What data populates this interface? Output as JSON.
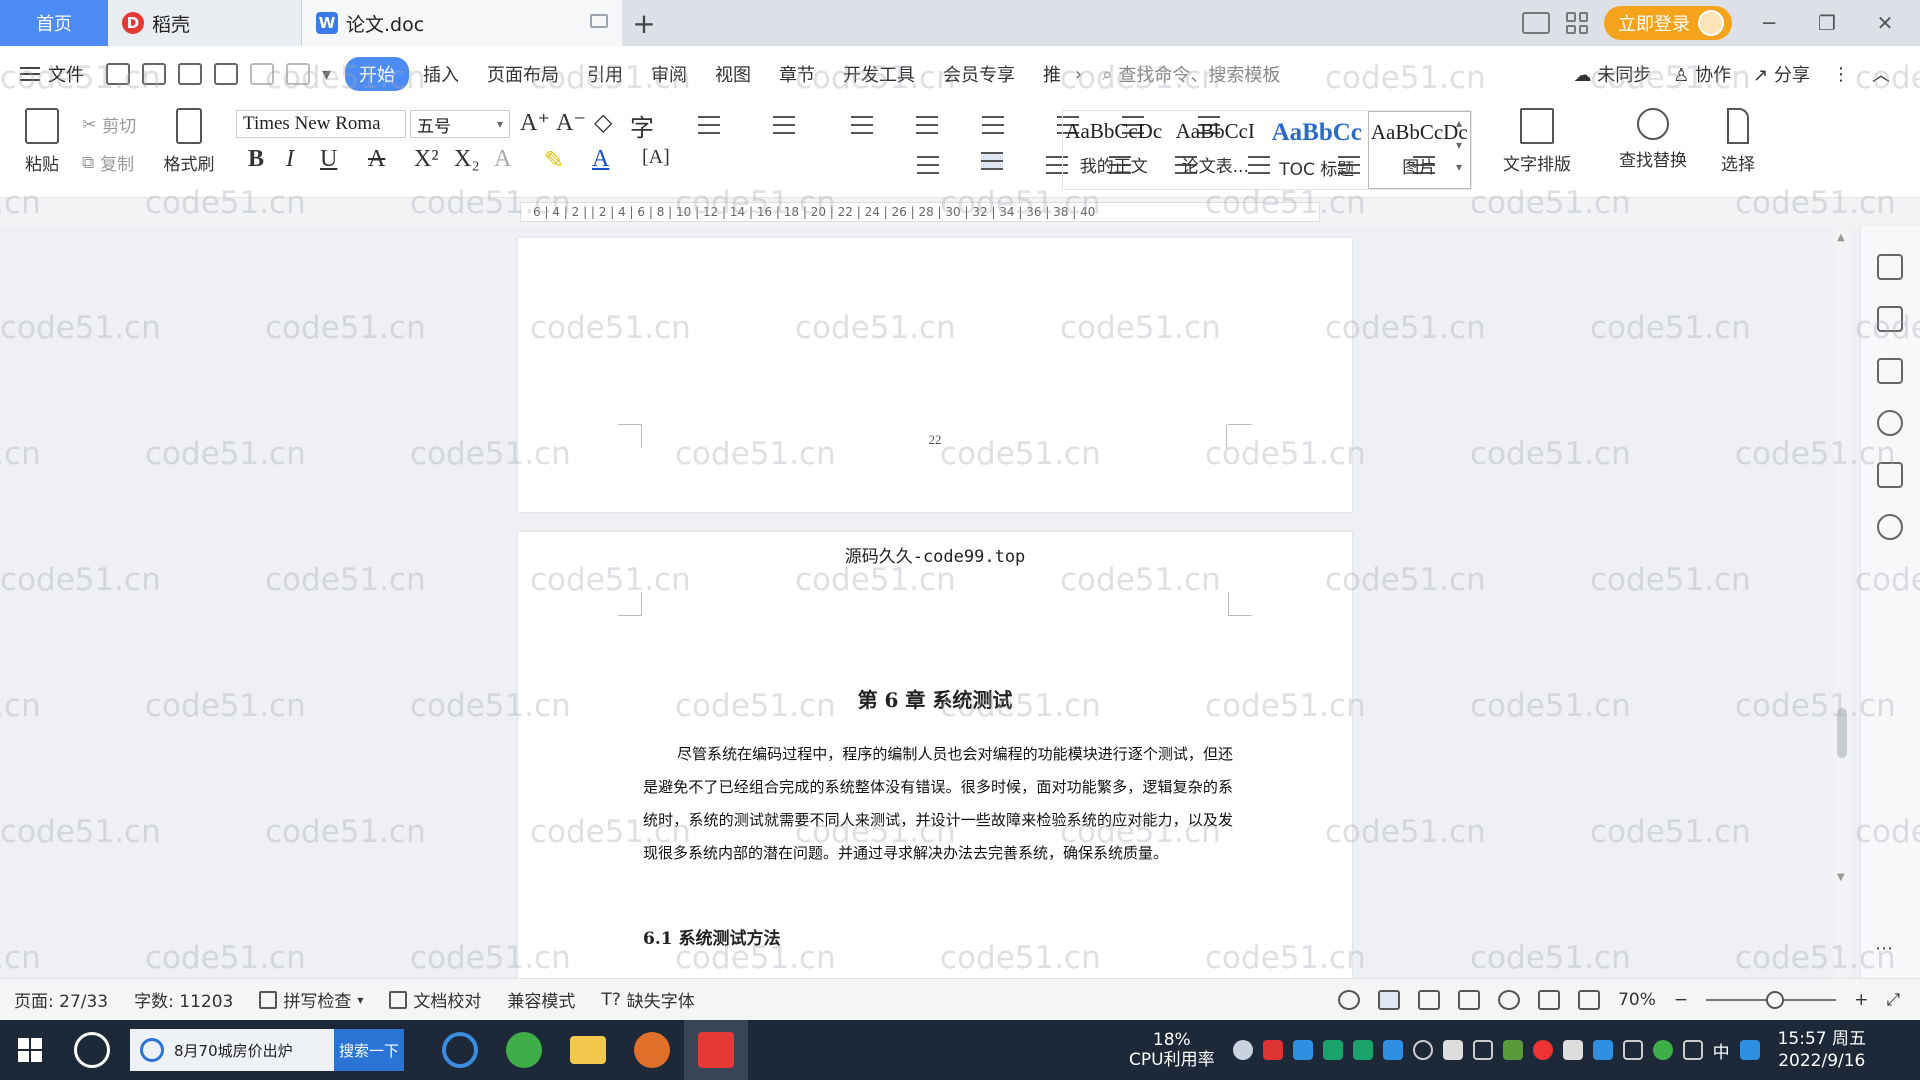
{
  "tabs": {
    "home": "首页",
    "daoke": "稻壳",
    "doc": "论文.doc"
  },
  "titlebar": {
    "login": "立即登录"
  },
  "menu": {
    "file": "文件",
    "items": [
      "开始",
      "插入",
      "页面布局",
      "引用",
      "审阅",
      "视图",
      "章节",
      "开发工具",
      "会员专享",
      "推"
    ],
    "search_cmd": "查找命令、搜索模板",
    "unsynced": "未同步",
    "collab": "协作",
    "share": "分享"
  },
  "ribbon": {
    "paste": "粘贴",
    "cut": "剪切",
    "copy": "复制",
    "format_painter": "格式刷",
    "font_name": "Times New Roma",
    "font_size": "五号",
    "styles": [
      {
        "sample": "AaBbCcDc",
        "label": "我的正文"
      },
      {
        "sample": "AaBbCcI",
        "label": "论文表..."
      },
      {
        "sample": "AaBbCc",
        "label": "TOC 标题"
      },
      {
        "sample": "AaBbCcDc",
        "label": "图片"
      }
    ],
    "text_layout": "文字排版",
    "find_replace": "查找替换",
    "select": "选择"
  },
  "ruler": {
    "ticks": "6 | 4 | 2 |   | 2 | 4 | 6 | 8 | 10 | 12 | 14 | 16 | 18 | 20 | 22 | 24 | 26 | 28 | 30 | 32 | 34 | 36 | 38 | 40"
  },
  "document": {
    "prev_page_number": "22",
    "header": "源码久久-code99.top",
    "chapter_title": "第 6 章  系统测试",
    "paragraph": "尽管系统在编码过程中，程序的编制人员也会对编程的功能模块进行逐个测试，但还是避免不了已经组合完成的系统整体没有错误。很多时候，面对功能繁多，逻辑复杂的系统时，系统的测试就需要不同人来测试，并设计一些故障来检验系统的应对能力，以及发现很多系统内部的潜在问题。并通过寻求解决办法去完善系统，确保系统质量。",
    "section_title": "6.1  系统测试方法"
  },
  "watermark": "code51.cn",
  "status": {
    "page": "页面: 27/33",
    "words": "字数: 11203",
    "spellcheck": "拼写检查",
    "proofread": "文档校对",
    "compat": "兼容模式",
    "missing_font": "缺失字体",
    "zoom": "70%"
  },
  "taskbar": {
    "search_text": "8月70城房价出炉",
    "search_button": "搜索一下",
    "cpu_pct": "18%",
    "cpu_label": "CPU利用率",
    "ime": "中",
    "time": "15:57 周五",
    "date": "2022/9/16"
  },
  "colors": {
    "accent": "#4d8cf5",
    "login": "#f5a31a",
    "taskbar": "#1d2838"
  }
}
